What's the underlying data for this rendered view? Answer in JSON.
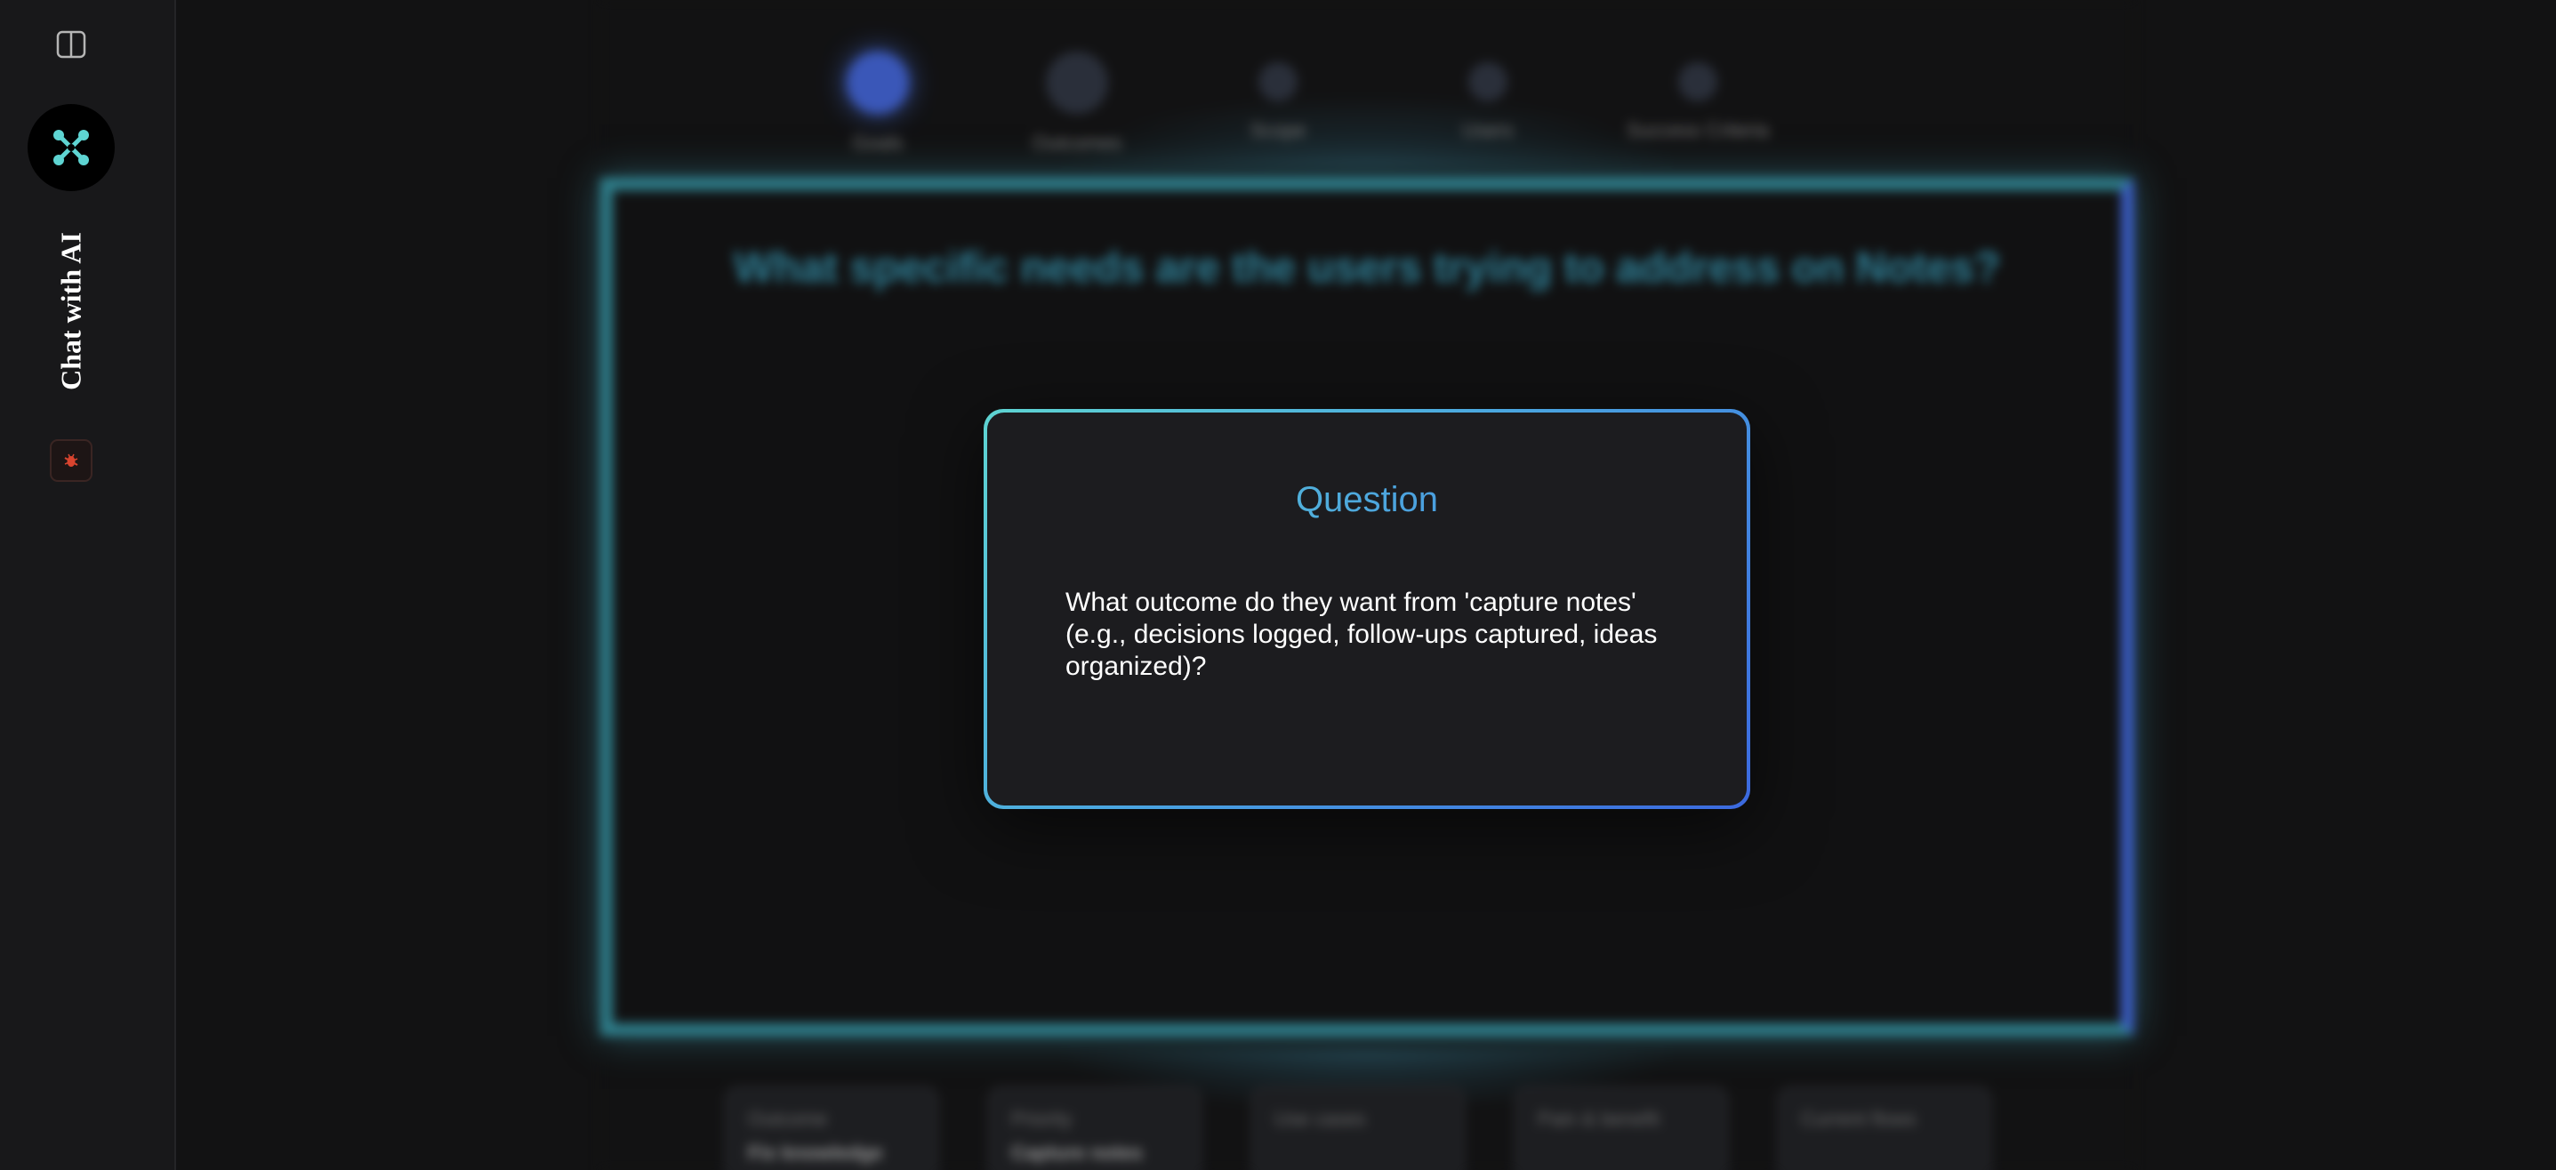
{
  "sidebar": {
    "title": "Chat with AI"
  },
  "background": {
    "steps": [
      "Goals",
      "Outcomes",
      "Scope",
      "Users",
      "Success Criteria"
    ],
    "question": "What specific needs are the users trying to address on Notes?",
    "chips": [
      {
        "label": "Outcome",
        "value": "Fix knowledge"
      },
      {
        "label": "Priority",
        "value": "Capture notes"
      },
      {
        "label": "Use cases",
        "value": ""
      },
      {
        "label": "Pain & benefit",
        "value": ""
      },
      {
        "label": "Current flows",
        "value": ""
      }
    ]
  },
  "modal": {
    "title": "Question",
    "body": "What outcome do they want from 'capture notes' (e.g., decisions logged, follow-ups captured, ideas organized)?"
  },
  "colors": {
    "accent_teal": "#5ed4d2",
    "accent_blue": "#3b69df",
    "bug_red": "#d8442f"
  },
  "icons": {
    "toggle": "sidebar-toggle-icon",
    "logo": "network-logo-icon",
    "bug": "bug-icon"
  }
}
